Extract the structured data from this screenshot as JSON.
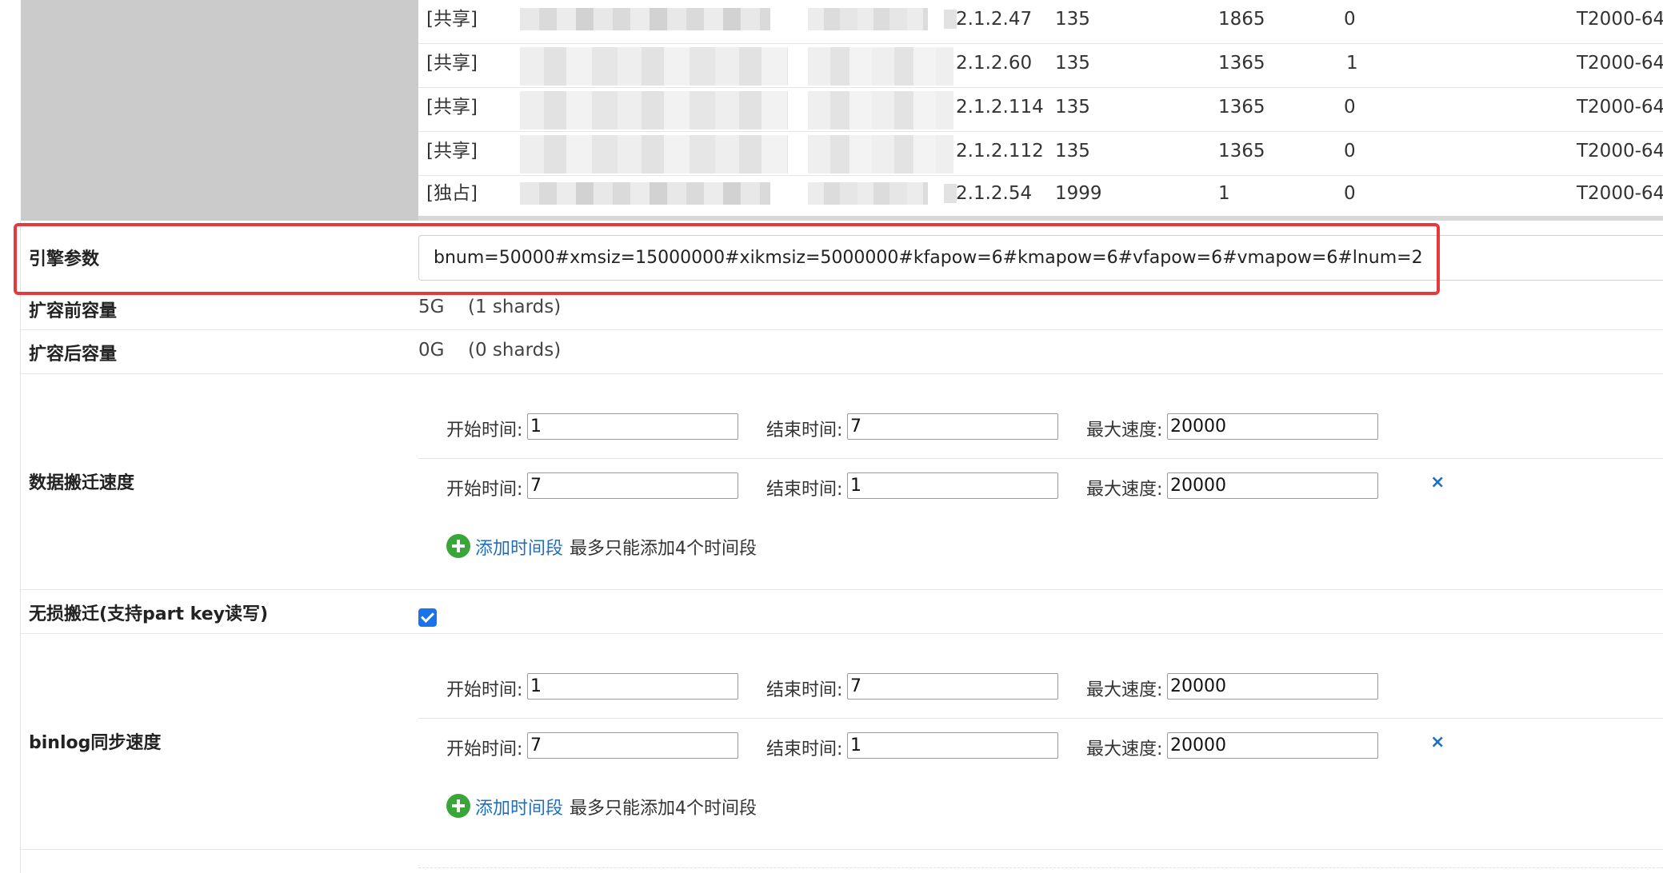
{
  "instances": [
    {
      "tag": "[共享]",
      "tag_type": "share",
      "ip": "2.1.2.47",
      "c1": "135",
      "c2": "1865",
      "c3": "0",
      "model": "T2000-64"
    },
    {
      "tag": "[共享]",
      "tag_type": "share",
      "ip": "2.1.2.60",
      "c1": "135",
      "c2": "1365",
      "c3": "1",
      "model": "T2000-64"
    },
    {
      "tag": "[共享]",
      "tag_type": "share",
      "ip": "2.1.2.114",
      "c1": "135",
      "c2": "1365",
      "c3": "0",
      "model": "T2000-64"
    },
    {
      "tag": "[共享]",
      "tag_type": "share",
      "ip": "2.1.2.112",
      "c1": "135",
      "c2": "1365",
      "c3": "0",
      "model": "T2000-64"
    },
    {
      "tag": "[独占]",
      "tag_type": "exclusive",
      "ip": "2.1.2.54",
      "c1": "1999",
      "c2": "1",
      "c3": "0",
      "model": "T2000-64"
    }
  ],
  "engine": {
    "label": "引擎参数",
    "value": "bnum=50000#xmsiz=15000000#xikmsiz=5000000#kfapow=6#kmapow=6#vfapow=6#vmapow=6#lnum=2"
  },
  "capacity_before": {
    "label": "扩容前容量",
    "size": "5G",
    "shards": "(1 shards)"
  },
  "capacity_after": {
    "label": "扩容后容量",
    "size": "0G",
    "shards": "(0 shards)"
  },
  "labels": {
    "start": "开始时间:",
    "end": "结束时间:",
    "max_speed": "最大速度:",
    "remove": "×",
    "add_segment": "添加时间段",
    "add_hint": "最多只能添加4个时间段"
  },
  "migrate_speed": {
    "label": "数据搬迁速度",
    "segments": [
      {
        "start": "1",
        "end": "7",
        "max": "20000"
      },
      {
        "start": "7",
        "end": "1",
        "max": "20000"
      }
    ]
  },
  "lossless": {
    "label": "无损搬迁(支持part key读写)",
    "checked": true
  },
  "binlog_speed": {
    "label": "binlog同步速度",
    "segments": [
      {
        "start": "1",
        "end": "7",
        "max": "20000"
      },
      {
        "start": "7",
        "end": "1",
        "max": "20000"
      }
    ]
  },
  "colors": {
    "highlight": "#e5393e",
    "share_tag": "#3aa63a",
    "exclusive_tag": "#e8951e",
    "link": "#1f6fc0",
    "checkbox": "#1a73e8"
  }
}
